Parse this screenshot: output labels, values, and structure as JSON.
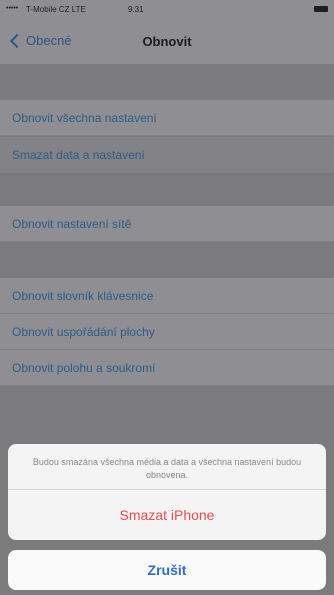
{
  "statusbar": {
    "signal": "•••••",
    "carrier": "T-Mobile CZ  LTE",
    "time": "9:31"
  },
  "navbar": {
    "back_label": "Obecné",
    "title": "Obnovit"
  },
  "list": {
    "items": [
      "Obnovit všechna nastavení",
      "Smazat data a nastavení",
      "Obnovit nastavení sítě",
      "Obnovit slovník klávesnice",
      "Obnovit uspořádání plochy",
      "Obnovit polohu a soukromí"
    ]
  },
  "sheet": {
    "message": "Budou smazána všechna média a data a všechna nastavení budou obnovena.",
    "destructive_label": "Smazat iPhone",
    "cancel_label": "Zrušit"
  },
  "colors": {
    "link": "#2b5c8a",
    "destructive": "#ea4d4d",
    "cancel": "#2d6ec2"
  }
}
